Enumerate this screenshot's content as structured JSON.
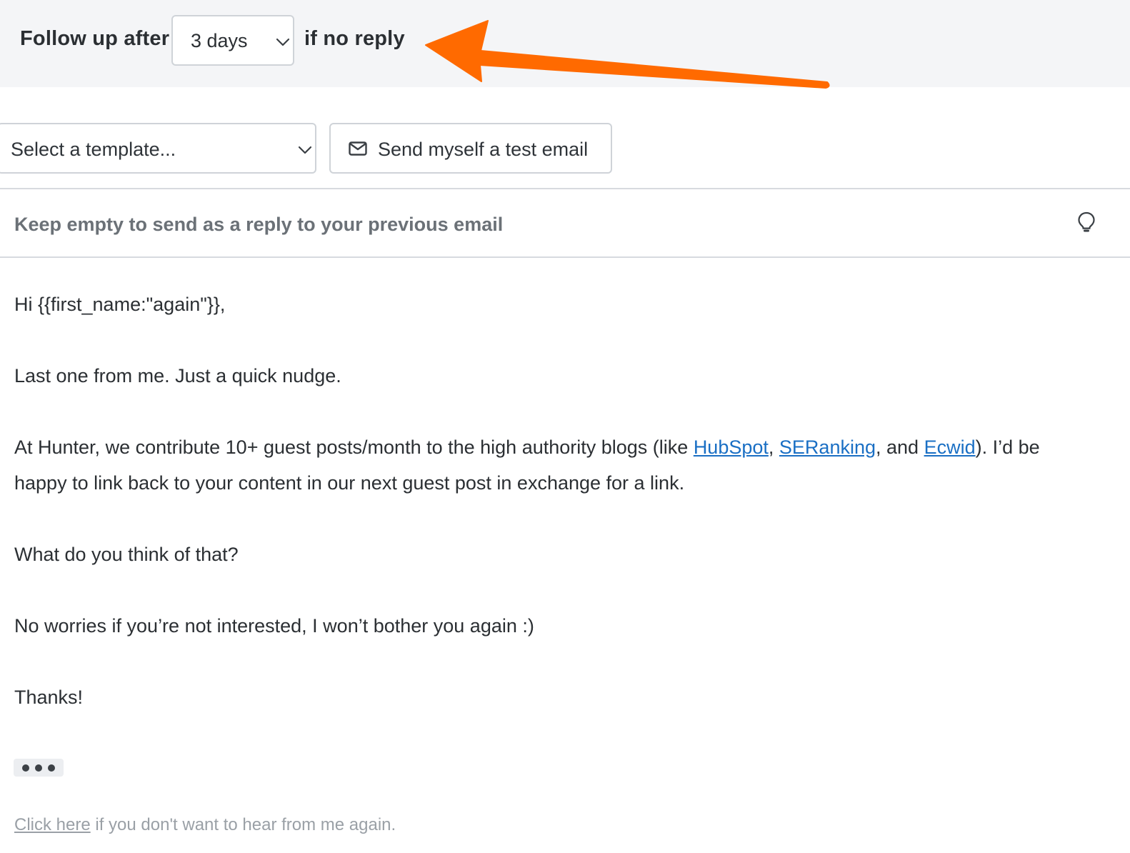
{
  "followup": {
    "prefix": "Follow up after",
    "delay_value": "3 days",
    "suffix": "if no reply"
  },
  "toolbar": {
    "template_placeholder": "Select a template...",
    "test_email_label": "Send myself a test email"
  },
  "subject": {
    "placeholder": "Keep empty to send as a reply to your previous email"
  },
  "email_body": {
    "greeting": "Hi {{first_name:\"again\"}},",
    "line1": "Last one from me. Just a quick nudge.",
    "para_start": "At Hunter, we contribute 10+ guest posts/month to the high authority blogs (like ",
    "link_hubspot": "HubSpot",
    "sep1": ", ",
    "link_seranking": "SERanking",
    "sep2": ", and ",
    "link_ecwid": "Ecwid",
    "para_end": "). I’d be",
    "para_line2": "happy to link back to your content in our next guest post in exchange for a link.",
    "question": "What do you think of that?",
    "no_worries": "No worries if you’re not interested, I won’t bother you again :)",
    "thanks": "Thanks!"
  },
  "footer": {
    "unsubscribe_link": "Click here",
    "unsubscribe_text": " if you don't want to hear from me again."
  },
  "icons": {
    "delay_chevron": "chevron-down-icon",
    "template_chevron": "chevron-down-icon",
    "test_email": "envelope-icon",
    "subject_hint": "lightbulb-icon",
    "annotation": "arrow-icon"
  },
  "colors": {
    "annotation_arrow": "#ff6a00",
    "link": "#1a6fc4",
    "bar_background": "#f4f5f7"
  }
}
